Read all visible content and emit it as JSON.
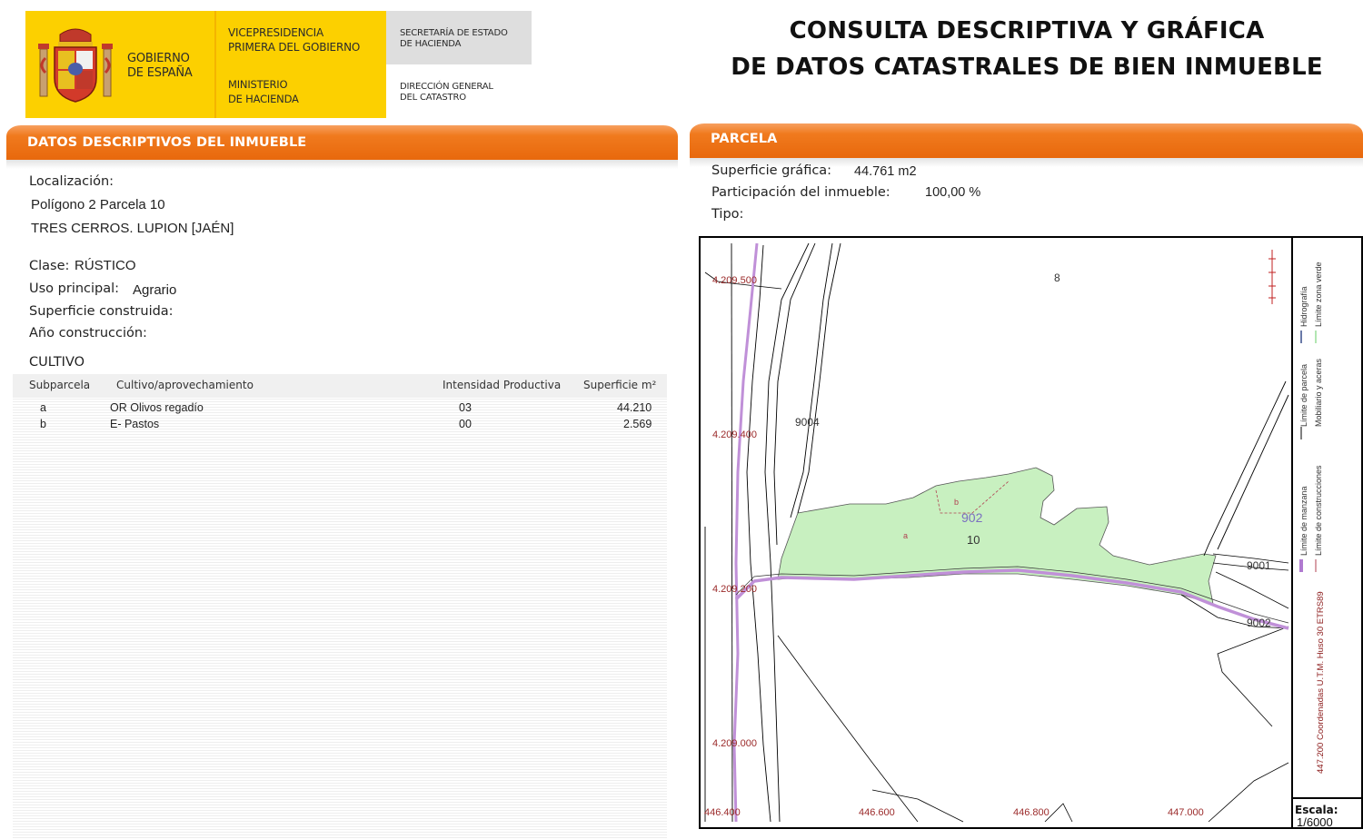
{
  "header": {
    "gobierno_line1": "GOBIERNO",
    "gobierno_line2": "DE ESPAÑA",
    "vice_line1": "VICEPRESIDENCIA",
    "vice_line2": "PRIMERA DEL GOBIERNO",
    "ministerio_line1": "MINISTERIO",
    "ministerio_line2": "DE HACIENDA",
    "secretaria_line1": "SECRETARÍA DE ESTADO",
    "secretaria_line2": "DE HACIENDA",
    "direccion_line1": "DIRECCIÓN GENERAL",
    "direccion_line2": "DEL CATASTRO",
    "title_line1": "CONSULTA DESCRIPTIVA Y GRÁFICA",
    "title_line2": "DE DATOS CATASTRALES DE BIEN INMUEBLE"
  },
  "datos": {
    "section_title": "DATOS DESCRIPTIVOS DEL INMUEBLE",
    "localizacion_label": "Localización:",
    "localizacion_line1": "Polígono 2 Parcela 10",
    "localizacion_line2": "TRES CERROS. LUPION [JAÉN]",
    "clase_label": "Clase:",
    "clase_value": "RÚSTICO",
    "uso_label": "Uso principal:",
    "uso_value": "Agrario",
    "superficie_construida_label": "Superficie construida:",
    "anio_label": "Año construcción:"
  },
  "cultivo": {
    "title": "CULTIVO",
    "headers": [
      "Subparcela",
      "Cultivo/aprovechamiento",
      "Intensidad Productiva",
      "Superficie m²"
    ],
    "rows": [
      {
        "subparcela": "a",
        "cultivo": "OR Olivos regadío",
        "intensidad": "03",
        "superficie": "44.210"
      },
      {
        "subparcela": "b",
        "cultivo": "E- Pastos",
        "intensidad": "00",
        "superficie": "2.569"
      }
    ]
  },
  "parcela": {
    "section_title": "PARCELA",
    "superficie_label": "Superficie gráfica:",
    "superficie_value": "44.761 m2",
    "participacion_label": "Participación del inmueble:",
    "participacion_value": "100,00 %",
    "tipo_label": "Tipo:"
  },
  "map": {
    "y_coords": [
      "4.209.500",
      "4.209.400",
      "4.209.200",
      "4.209.000"
    ],
    "x_coords": [
      "446.400",
      "446.600",
      "446.800",
      "447.000"
    ],
    "labels": {
      "parcel_8": "8",
      "parcel_9004": "9004",
      "parcel_902": "902",
      "parcel_10": "10",
      "sub_a": "a",
      "sub_b": "b",
      "parcel_9001": "9001",
      "parcel_9002": "9002"
    },
    "colors": {
      "parcel_fill": "#c8f0c0",
      "boundary_purple": "#c090d8",
      "coord_red": "#9b2a2a"
    },
    "legend": {
      "item1": "Límite de manzana",
      "item2": "Límite de parcela",
      "item3": "Hidrografía",
      "item4": "Límite de construcciones",
      "item5": "Mobiliario y aceras",
      "item6": "Límite zona verde",
      "coords_text": "447.200 Coordenadas U.T.M. Huso 30 ETRS89"
    },
    "escala_label": "Escala:",
    "escala_value": "1/6000"
  }
}
